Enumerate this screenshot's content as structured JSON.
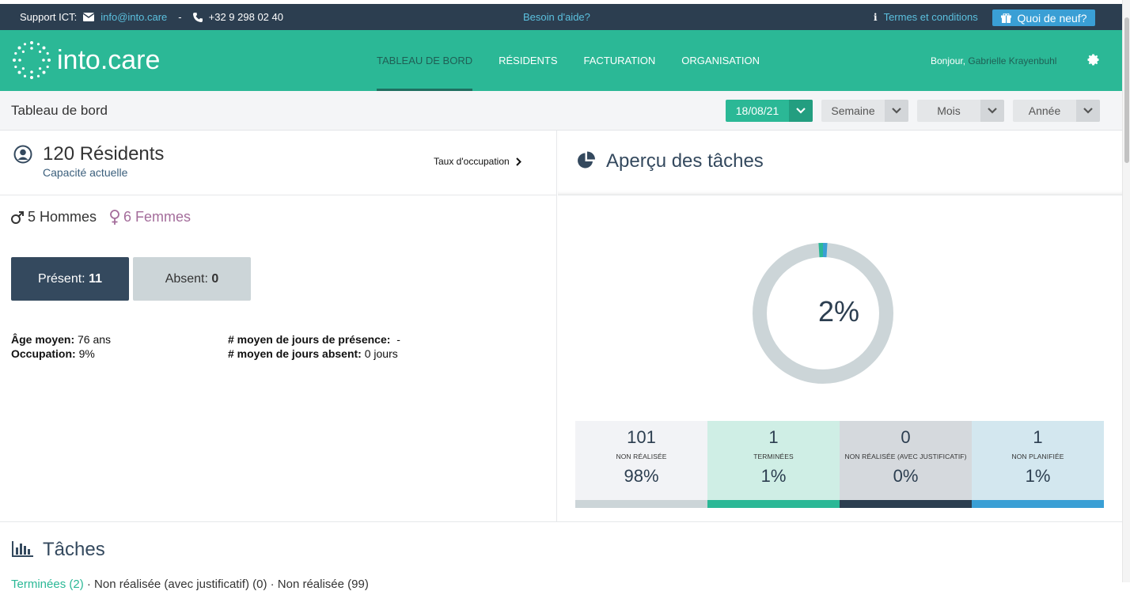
{
  "topbar": {
    "support_label": "Support ICT:",
    "email": "info@into.care",
    "separator": "-",
    "phone": "+32 9 298 02 40",
    "help": "Besoin d'aide?",
    "terms": "Termes et conditions",
    "whats_new": "Quoi de neuf?"
  },
  "navbar": {
    "logo_text": "into.care",
    "items": [
      {
        "label": "TABLEAU DE BORD",
        "active": true
      },
      {
        "label": "RÉSIDENTS",
        "active": false
      },
      {
        "label": "FACTURATION",
        "active": false
      },
      {
        "label": "ORGANISATION",
        "active": false
      }
    ],
    "greeting": "Bonjour,",
    "user_name": "Gabrielle Krayenbuhl"
  },
  "subbar": {
    "title": "Tableau de bord",
    "date": "18/08/21",
    "week": "Semaine",
    "month": "Mois",
    "year": "Année"
  },
  "residents": {
    "count_label": "120 Résidents",
    "subtitle": "Capacité actuelle",
    "occupancy_link": "Taux d'occupation",
    "men": "5 Hommes",
    "women": "6 Femmes",
    "present_label": "Présent:",
    "present_value": "11",
    "absent_label": "Absent:",
    "absent_value": "0",
    "avg_age_label": "Âge moyen:",
    "avg_age_value": "76 ans",
    "occupation_label": "Occupation:",
    "occupation_value": "9%",
    "avg_presence_label": "# moyen de jours de présence:",
    "avg_presence_value": "-",
    "avg_absent_label": "# moyen de jours absent:",
    "avg_absent_value": "0 jours"
  },
  "tasks_overview": {
    "title": "Aperçu des tâches",
    "donut_label": "2%",
    "done_fraction": 0.02,
    "colors": {
      "ring": "#ccd5d8",
      "done": "#2bb896",
      "planned": "#3a9fd5"
    },
    "tiles": [
      {
        "num": "101",
        "caption": "NON RÉALISÉE",
        "pct": "98%",
        "bg": "#f2f3f6",
        "bar": "#ccd5d8"
      },
      {
        "num": "1",
        "caption": "TERMINÉES",
        "pct": "1%",
        "bg": "#cfeee5",
        "bar": "#2bb896"
      },
      {
        "num": "0",
        "caption": "NON RÉALISÉE (AVEC JUSTIFICATIF)",
        "pct": "0%",
        "bg": "#d5d9dd",
        "bar": "#2c3e50"
      },
      {
        "num": "1",
        "caption": "NON PLANIFIÉE",
        "pct": "1%",
        "bg": "#d3e7ef",
        "bar": "#3a9fd5"
      }
    ]
  },
  "tasks_section": {
    "title": "Tâches",
    "legend_done": "Terminées (2)",
    "legend_rest": "· Non réalisée (avec justificatif) (0) · Non réalisée (99)"
  }
}
